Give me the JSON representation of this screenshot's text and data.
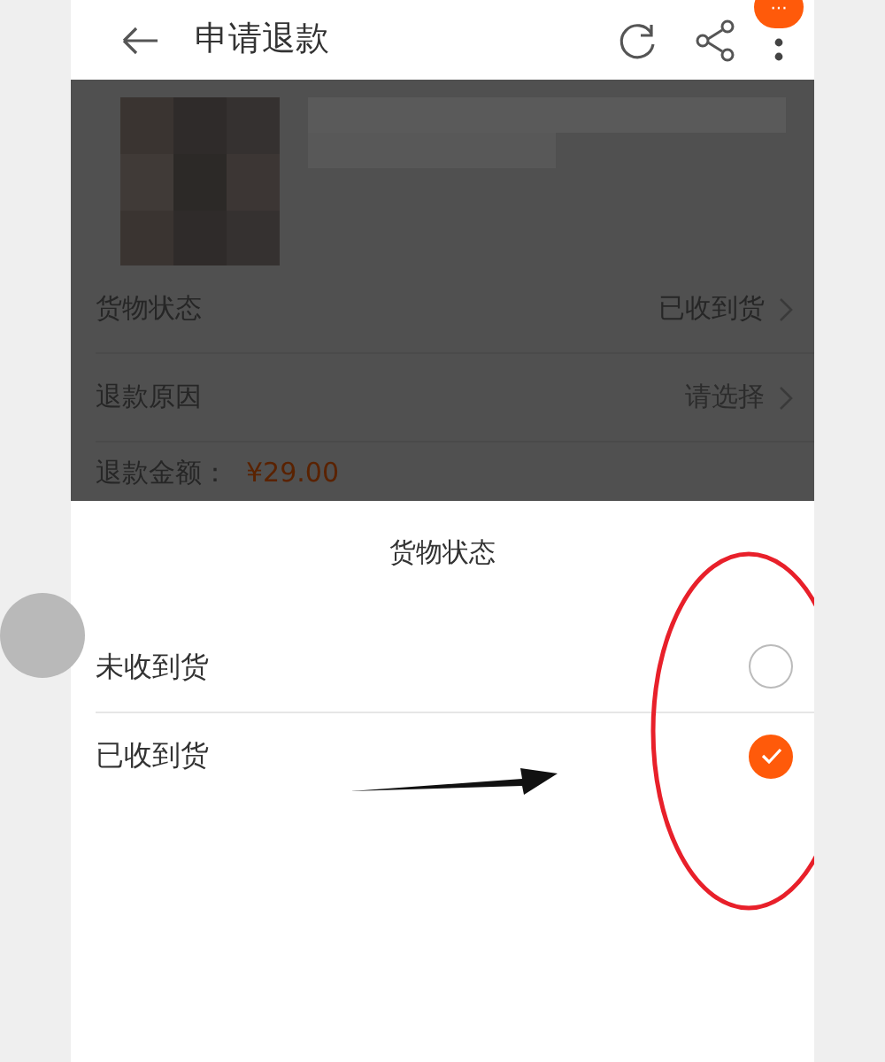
{
  "header": {
    "title": "申请退款",
    "badge": "···"
  },
  "form_rows": [
    {
      "label": "货物状态",
      "value": "已收到货",
      "kind": "value"
    },
    {
      "label": "退款原因",
      "value": "请选择",
      "kind": "placeholder"
    }
  ],
  "amount": {
    "label": "退款金额：",
    "value": "¥29.00"
  },
  "sheet": {
    "title": "货物状态",
    "options": [
      {
        "label": "未收到货",
        "selected": false
      },
      {
        "label": "已收到货",
        "selected": true
      }
    ]
  }
}
